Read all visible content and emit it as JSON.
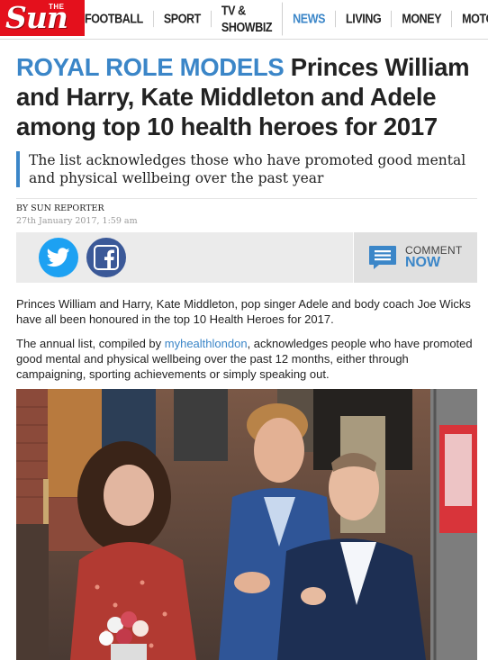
{
  "site": {
    "logo_small": "THE",
    "logo_word": "Sun",
    "brand_color": "#e4101c",
    "accent_color": "#3b86c8"
  },
  "nav": {
    "items": [
      {
        "label": "Football",
        "active": false
      },
      {
        "label": "Sport",
        "active": false
      },
      {
        "label": "TV & Showbiz",
        "active": false
      },
      {
        "label": "News",
        "active": true
      },
      {
        "label": "Living",
        "active": false
      },
      {
        "label": "Money",
        "active": false
      },
      {
        "label": "Motors",
        "active": false
      }
    ]
  },
  "article": {
    "kicker": "ROYAL ROLE MODELS",
    "headline": "Princes William and Harry, Kate Middleton and Adele among top 10 health heroes for 2017",
    "standfirst": "The list acknowledges those who have promoted good mental and physical wellbeing over the past year",
    "byline": "By Sun Reporter",
    "date": "27th January 2017, 1:59 am",
    "share": {
      "twitter_icon": "twitter-icon",
      "facebook_icon": "facebook-icon",
      "comment_label": "Comment",
      "comment_now": "Now",
      "comment_icon": "comment-list-icon"
    },
    "paragraph1": "Princes William and Harry, Kate Middleton, pop singer Adele and body coach Joe Wicks have all been honoured in the top 10 Health Heroes for 2017.",
    "paragraph2_before": "The annual list, compiled by ",
    "paragraph2_link": "myhealthlondon",
    "paragraph2_after": ", acknowledges people who have promoted good mental and physical wellbeing over the past 12 months, either through campaigning, sporting achievements or simply speaking out."
  }
}
